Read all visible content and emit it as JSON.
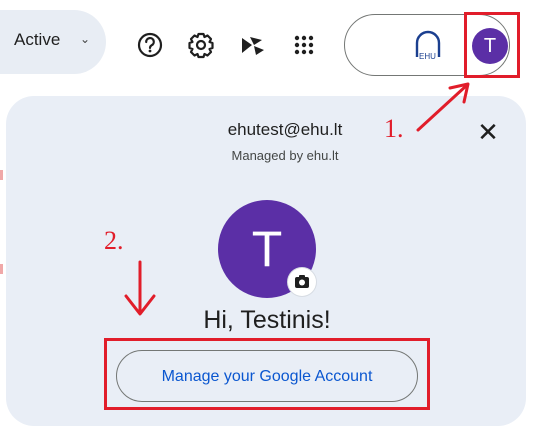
{
  "toolbar": {
    "status_label": "Active",
    "status_caret": "⌄",
    "icons": [
      "help-icon",
      "settings-icon",
      "gemini-icon",
      "apps-grid-icon"
    ]
  },
  "account_pill": {
    "org_logo_text": "EHU",
    "avatar_letter": "T"
  },
  "account_popup": {
    "email": "ehutest@ehu.lt",
    "managed_by": "Managed by ehu.lt",
    "avatar_letter": "T",
    "greeting": "Hi, Testinis!",
    "manage_account_label": "Manage your Google Account",
    "close_symbol": "✕"
  },
  "annotations": {
    "step1": "1.",
    "step2": "2."
  },
  "colors": {
    "accent_red": "#e11d2a",
    "avatar_purple": "#5b2fa6",
    "link_blue": "#0b57d0",
    "panel_bg": "#e9eef6"
  }
}
